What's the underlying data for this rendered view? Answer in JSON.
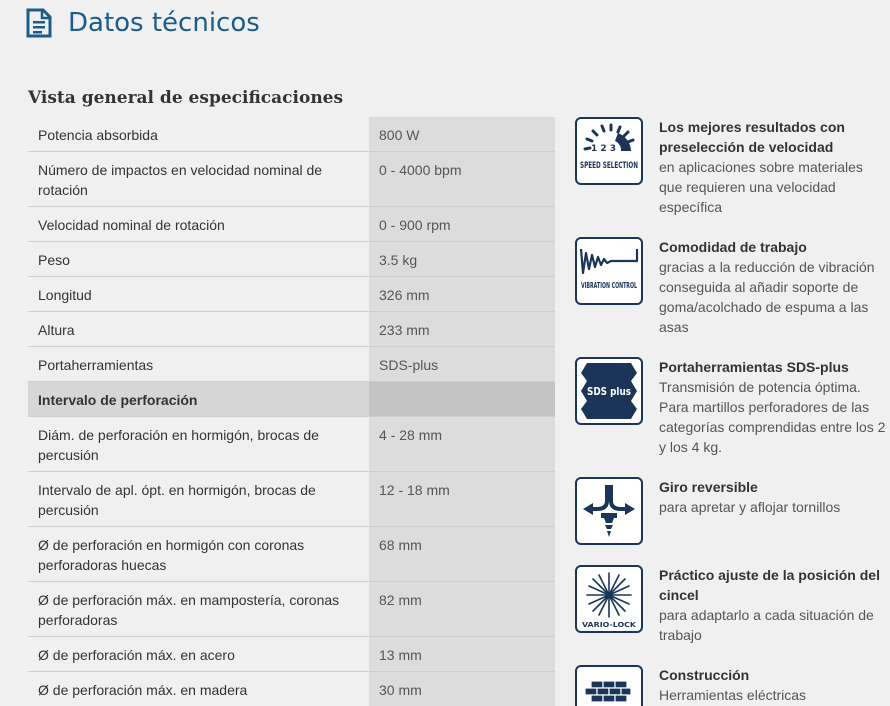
{
  "page": {
    "title": "Datos técnicos",
    "header_icon": "document-icon"
  },
  "specs": {
    "section_title": "Vista general de especificaciones",
    "rows": [
      {
        "label": "Potencia absorbida",
        "value": "800 W"
      },
      {
        "label": "Número de impactos en velocidad nominal de rotación",
        "value": "0 - 4000 bpm"
      },
      {
        "label": "Velocidad nominal de rotación",
        "value": "0 - 900 rpm"
      },
      {
        "label": "Peso",
        "value": "3.5 kg"
      },
      {
        "label": "Longitud",
        "value": "326 mm"
      },
      {
        "label": "Altura",
        "value": "233 mm"
      },
      {
        "label": "Portaherramientas",
        "value": "SDS-plus"
      },
      {
        "label": "Intervalo de perforación",
        "value": ""
      },
      {
        "label": "Diám. de perforación en hormigón, brocas de percusión",
        "value": "4 - 28 mm"
      },
      {
        "label": "Intervalo de apl. ópt. en hormigón, brocas de percusión",
        "value": "12 - 18 mm"
      },
      {
        "label": "Ø de perforación en hormigón con coronas perforadoras huecas",
        "value": "68 mm"
      },
      {
        "label": "Ø de perforación máx. en mampostería, coronas perforadoras",
        "value": "82 mm"
      },
      {
        "label": "Ø de perforación máx. en acero",
        "value": "13 mm"
      },
      {
        "label": "Ø de perforación máx. en madera",
        "value": "30 mm"
      }
    ]
  },
  "features": [
    {
      "icon": "speed-selection-icon",
      "icon_text": "SPEED SELECTION",
      "icon_digits": "1 2 3",
      "title": "Los mejores resultados con preselección de velocidad",
      "desc": "en aplicaciones sobre materiales que requieren una velocidad específica"
    },
    {
      "icon": "vibration-control-icon",
      "icon_text": "VIBRATION CONTROL",
      "title": "Comodidad de trabajo",
      "desc": "gracias a la reducción de vibración conseguida al añadir soporte de goma/acolchado de espuma a las asas"
    },
    {
      "icon": "sds-plus-icon",
      "icon_text": "SDS plus",
      "title": "Portaherramientas SDS-plus",
      "desc": "Transmisión de potencia óptima. Para martillos perforadores de las categorías comprendidas entre los 2 y los 4 kg."
    },
    {
      "icon": "reverse-rotation-icon",
      "title": "Giro reversible",
      "desc": "para apretar y aflojar tornillos"
    },
    {
      "icon": "vario-lock-icon",
      "icon_text": "VARIO-LOCK",
      "title": "Práctico ajuste de la posición del cincel",
      "desc": "para adaptarlo a cada situación de trabajo"
    },
    {
      "icon": "construction-icon",
      "title": "Construcción",
      "desc": "Herramientas eléctricas"
    }
  ],
  "colors": {
    "accent": "#1a5c8a",
    "icon_navy": "#1b3558",
    "background": "#f0f0f0",
    "value_column": "#dcdcdc"
  }
}
